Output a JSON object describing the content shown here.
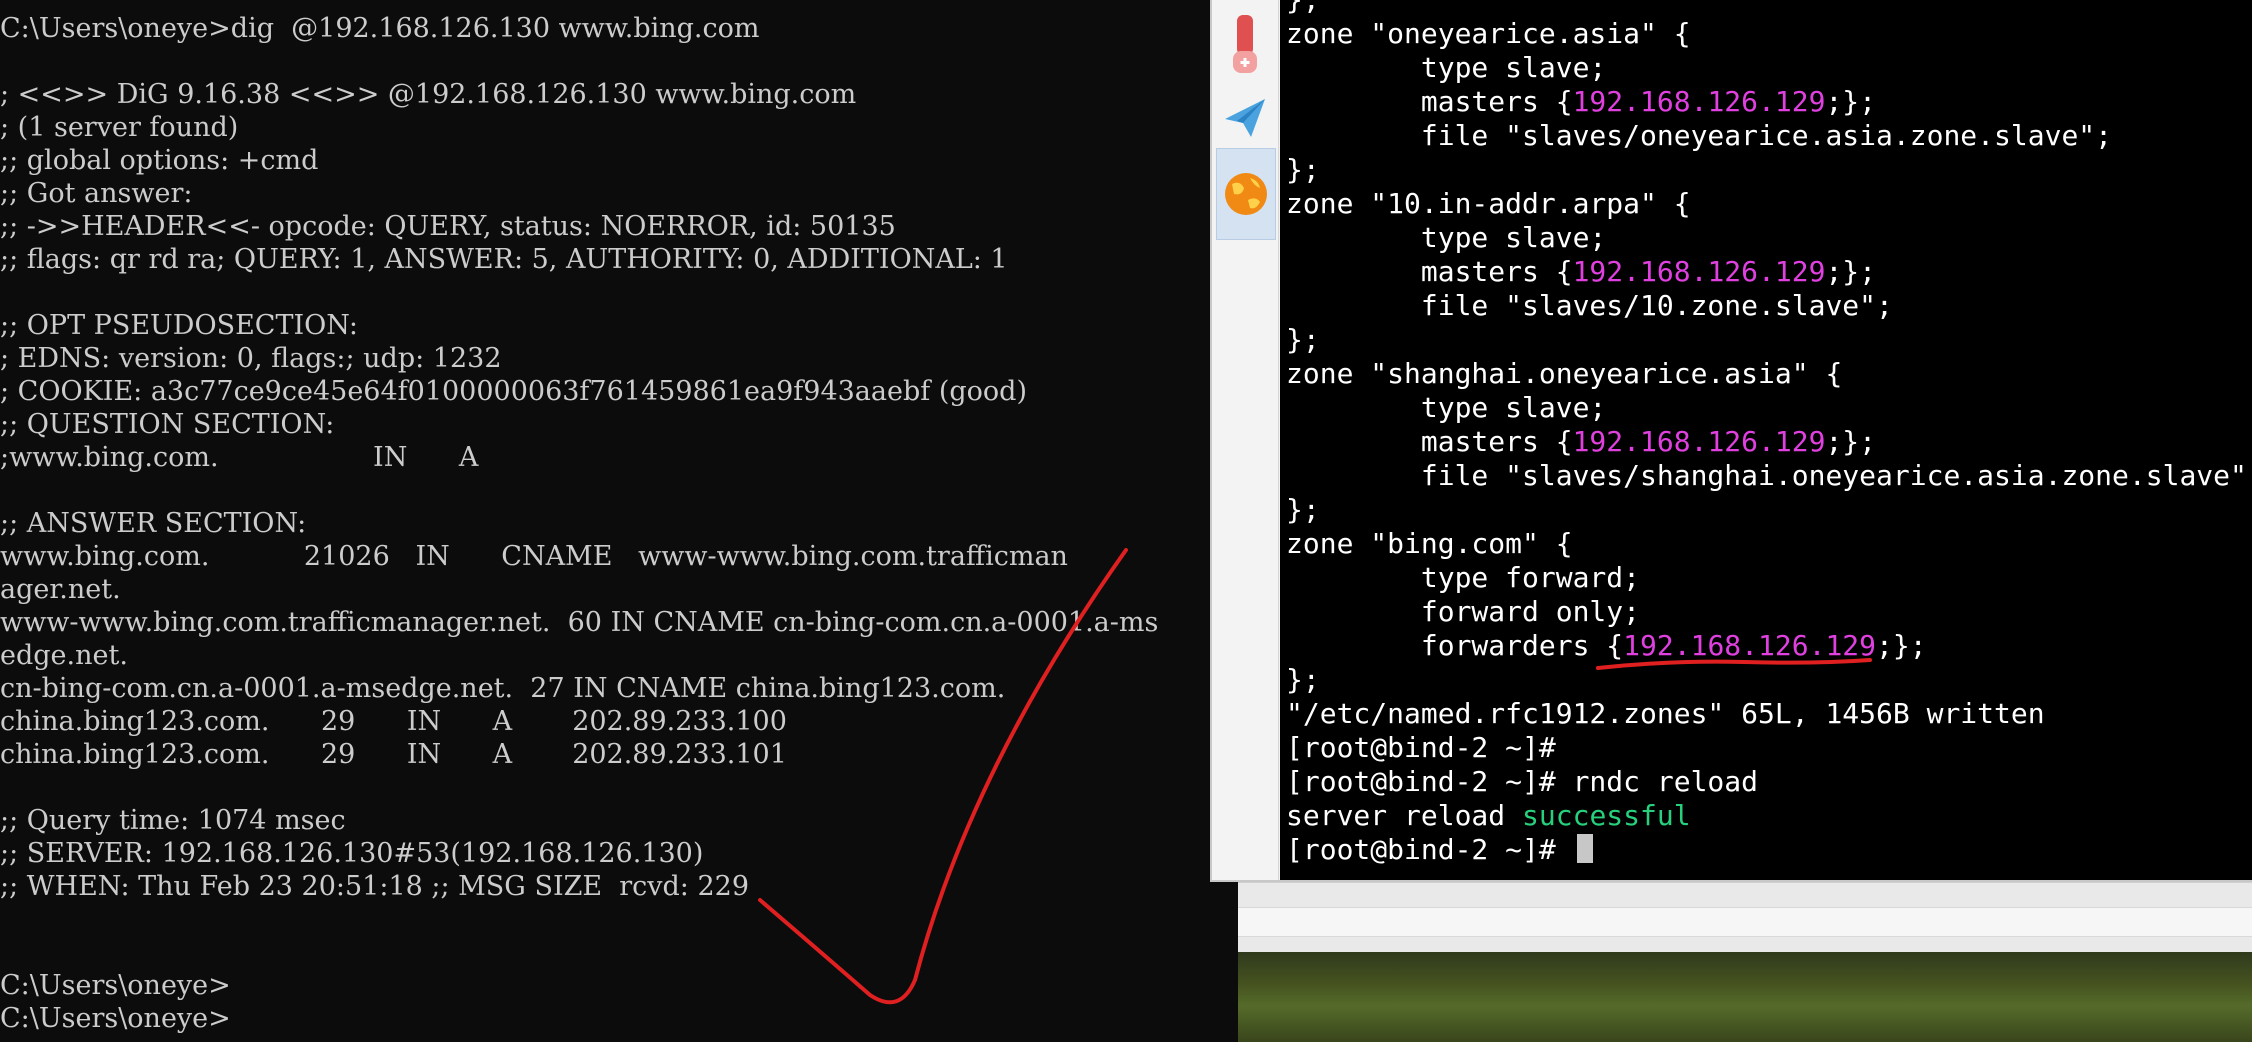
{
  "cmd": {
    "lines": [
      "C:\\Users\\oneye>dig  @192.168.126.130 www.bing.com",
      "",
      "; <<>> DiG 9.16.38 <<>> @192.168.126.130 www.bing.com",
      "; (1 server found)",
      ";; global options: +cmd",
      ";; Got answer:",
      ";; ->>HEADER<<- opcode: QUERY, status: NOERROR, id: 50135",
      ";; flags: qr rd ra; QUERY: 1, ANSWER: 5, AUTHORITY: 0, ADDITIONAL: 1",
      "",
      ";; OPT PSEUDOSECTION:",
      "; EDNS: version: 0, flags:; udp: 1232",
      "; COOKIE: a3c77ce9ce45e64f0100000063f761459861ea9f943aaebf (good)",
      ";; QUESTION SECTION:",
      ";www.bing.com.                  IN      A",
      "",
      ";; ANSWER SECTION:",
      "www.bing.com.           21026   IN      CNAME   www-www.bing.com.trafficman",
      "ager.net.",
      "www-www.bing.com.trafficmanager.net.  60 IN CNAME cn-bing-com.cn.a-0001.a-ms",
      "edge.net.",
      "cn-bing-com.cn.a-0001.a-msedge.net.  27 IN CNAME china.bing123.com.",
      "china.bing123.com.      29      IN      A       202.89.233.100",
      "china.bing123.com.      29      IN      A       202.89.233.101",
      "",
      ";; Query time: 1074 msec",
      ";; SERVER: 192.168.126.130#53(192.168.126.130)",
      ";; WHEN: Thu Feb 23 20:51:18 ;; MSG SIZE  rcvd: 229",
      "",
      "",
      "C:\\Users\\oneye>",
      "C:\\Users\\oneye>"
    ]
  },
  "terminal": {
    "lines": [
      {
        "pre": "};",
        "ip": "",
        "post": ""
      },
      {
        "pre": "zone \"oneyearice.asia\" {",
        "ip": "",
        "post": ""
      },
      {
        "pre": "        type slave;",
        "ip": "",
        "post": ""
      },
      {
        "pre": "        masters {",
        "ip": "192.168.126.129",
        "post": ";};"
      },
      {
        "pre": "        file \"slaves/oneyearice.asia.zone.slave\";",
        "ip": "",
        "post": ""
      },
      {
        "pre": "};",
        "ip": "",
        "post": ""
      },
      {
        "pre": "zone \"10.in-addr.arpa\" {",
        "ip": "",
        "post": ""
      },
      {
        "pre": "        type slave;",
        "ip": "",
        "post": ""
      },
      {
        "pre": "        masters {",
        "ip": "192.168.126.129",
        "post": ";};"
      },
      {
        "pre": "        file \"slaves/10.zone.slave\";",
        "ip": "",
        "post": ""
      },
      {
        "pre": "};",
        "ip": "",
        "post": ""
      },
      {
        "pre": "zone \"shanghai.oneyearice.asia\" {",
        "ip": "",
        "post": ""
      },
      {
        "pre": "        type slave;",
        "ip": "",
        "post": ""
      },
      {
        "pre": "        masters {",
        "ip": "192.168.126.129",
        "post": ";};"
      },
      {
        "pre": "        file \"slaves/shanghai.oneyearice.asia.zone.slave\";",
        "ip": "",
        "post": ""
      },
      {
        "pre": "};",
        "ip": "",
        "post": ""
      },
      {
        "pre": "zone \"bing.com\" {",
        "ip": "",
        "post": ""
      },
      {
        "pre": "        type forward;",
        "ip": "",
        "post": ""
      },
      {
        "pre": "        forward only;",
        "ip": "",
        "post": ""
      },
      {
        "pre": "        forwarders {",
        "ip": "192.168.126.129",
        "post": ";};"
      },
      {
        "pre": "};",
        "ip": "",
        "post": ""
      },
      {
        "pre": "\"/etc/named.rfc1912.zones\" 65L, 1456B written",
        "ip": "",
        "post": ""
      },
      {
        "pre": "[root@bind-2 ~]#",
        "ip": "",
        "post": ""
      },
      {
        "pre": "[root@bind-2 ~]# rndc reload",
        "ip": "",
        "post": ""
      }
    ],
    "reload_prefix": "server reload ",
    "reload_status": "successful",
    "prompt": "[root@bind-2 ~]# "
  },
  "dock": {
    "items": [
      {
        "icon": "tool-icon"
      },
      {
        "icon": "paper-plane-icon"
      },
      {
        "icon": "globe-icon",
        "active": true
      }
    ]
  },
  "colors": {
    "cmd_text": "#cccccc",
    "term_ip": "#e040e0",
    "term_success": "#26d07c",
    "annotation_red": "#e02020"
  }
}
